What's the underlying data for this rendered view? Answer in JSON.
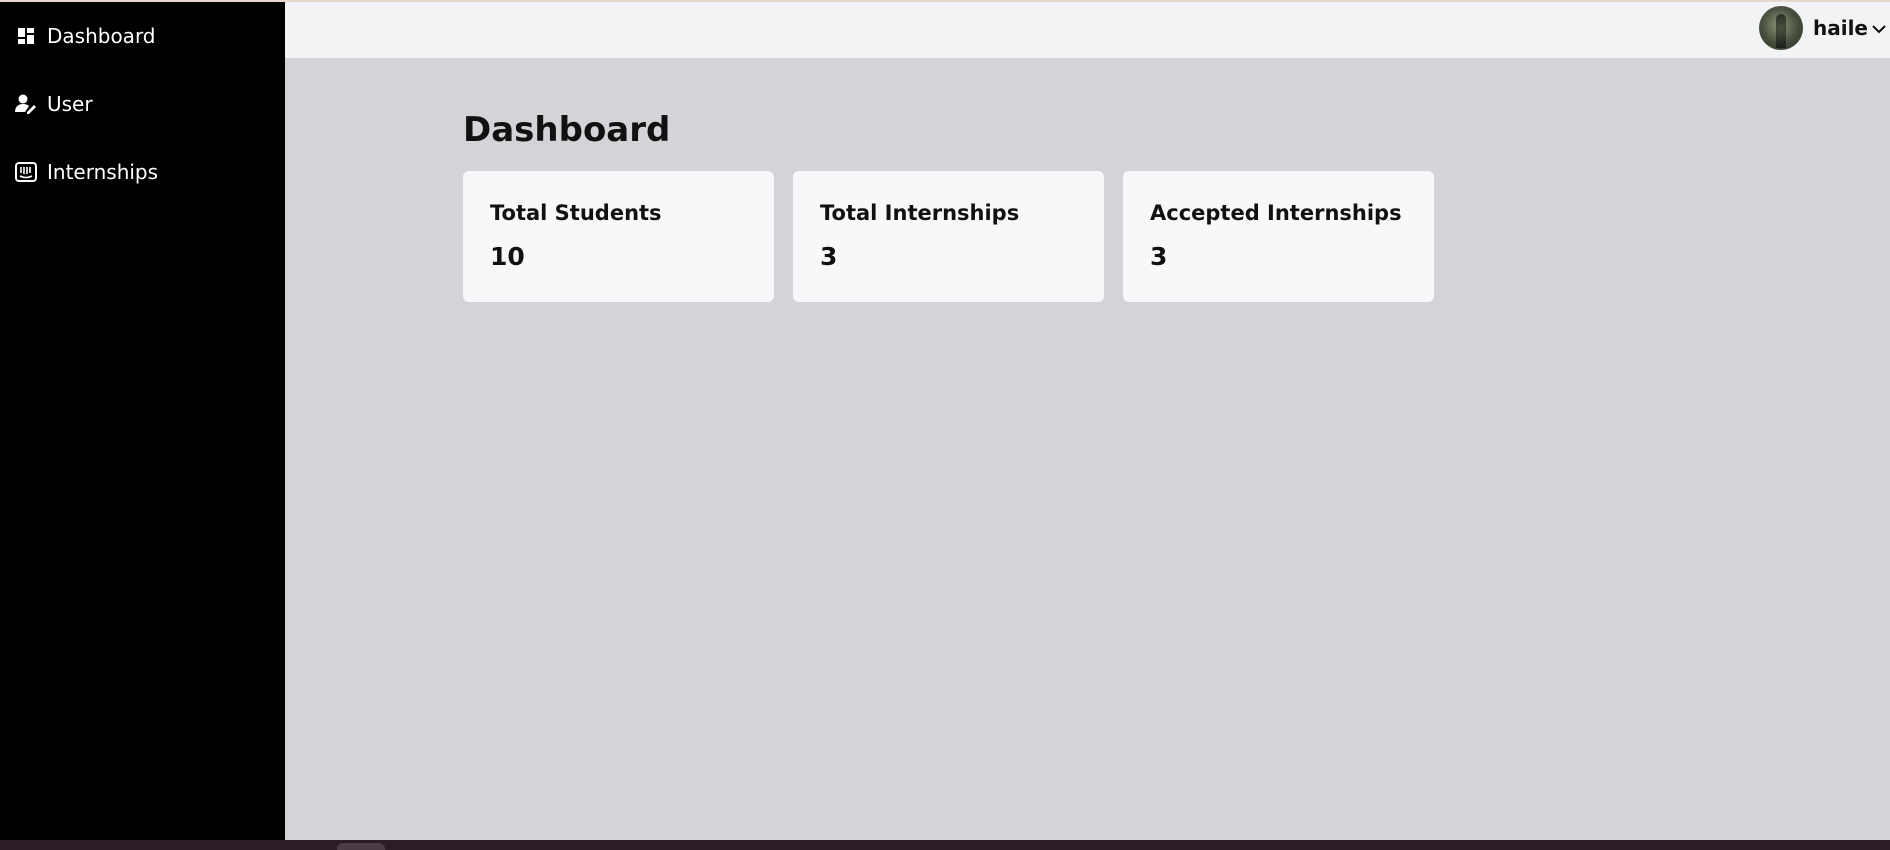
{
  "sidebar": {
    "items": [
      {
        "label": "Dashboard",
        "icon": "dashboard-icon"
      },
      {
        "label": "User",
        "icon": "user-edit-icon"
      },
      {
        "label": "Internships",
        "icon": "internships-icon"
      }
    ]
  },
  "header": {
    "user_name": "haile",
    "avatar_icon": "avatar",
    "menu_icon": "chevron-down-icon"
  },
  "main": {
    "title": "Dashboard",
    "cards": [
      {
        "label": "Total Students",
        "value": "10"
      },
      {
        "label": "Total Internships",
        "value": "3"
      },
      {
        "label": "Accepted Internships",
        "value": "3"
      }
    ]
  },
  "colors": {
    "sidebar_bg": "#000000",
    "content_bg": "#d4d3d8",
    "topbar_bg": "#f2f3f5",
    "card_bg": "#f7f8fa",
    "text": "#111111"
  }
}
